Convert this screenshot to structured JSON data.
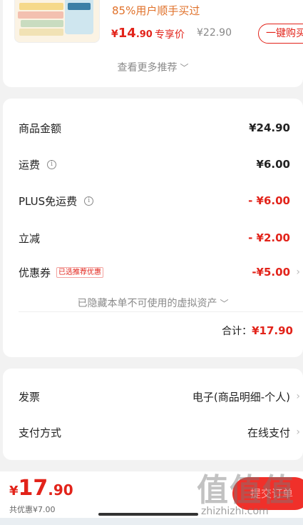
{
  "recommendation": {
    "bought_text": "85%用户顺手买过",
    "price_currency": "¥",
    "price_integer": "14",
    "price_decimal": ".90",
    "price_label": "专享价",
    "original_price": "¥22.90",
    "buy_button_label": "一键购买",
    "more_label": "查看更多推荐"
  },
  "price_summary": {
    "items": [
      {
        "label": "商品金额",
        "value": "¥24.90"
      },
      {
        "label": "运费",
        "value": "¥6.00"
      },
      {
        "label": "PLUS免运费",
        "value": "- ¥6.00"
      },
      {
        "label": "立减",
        "value": "- ¥2.00"
      },
      {
        "label": "优惠券",
        "value": "-¥5.00",
        "tag": "已选推荐优惠"
      }
    ],
    "hidden_assets_label": "已隐藏本单不可使用的虚拟资产",
    "total_label": "合计：",
    "total_value": "¥17.90"
  },
  "payment": {
    "invoice_label": "发票",
    "invoice_value": "电子(商品明细-个人)",
    "method_label": "支付方式",
    "method_value": "在线支付"
  },
  "bottom_bar": {
    "currency": "¥",
    "total_integer": "17",
    "total_decimal": ".90",
    "saved_text": "共优惠¥7.00",
    "submit_label": "提交订单"
  },
  "watermark": {
    "chars": "值值值",
    "url": "zhizhizhi.com"
  },
  "icons": {
    "info": "info-circle-icon",
    "chevron": "chevron-down-icon",
    "arrow": "chevron-right-icon"
  },
  "colors": {
    "accent_red": "#e2231a",
    "orange": "#e0712a"
  }
}
